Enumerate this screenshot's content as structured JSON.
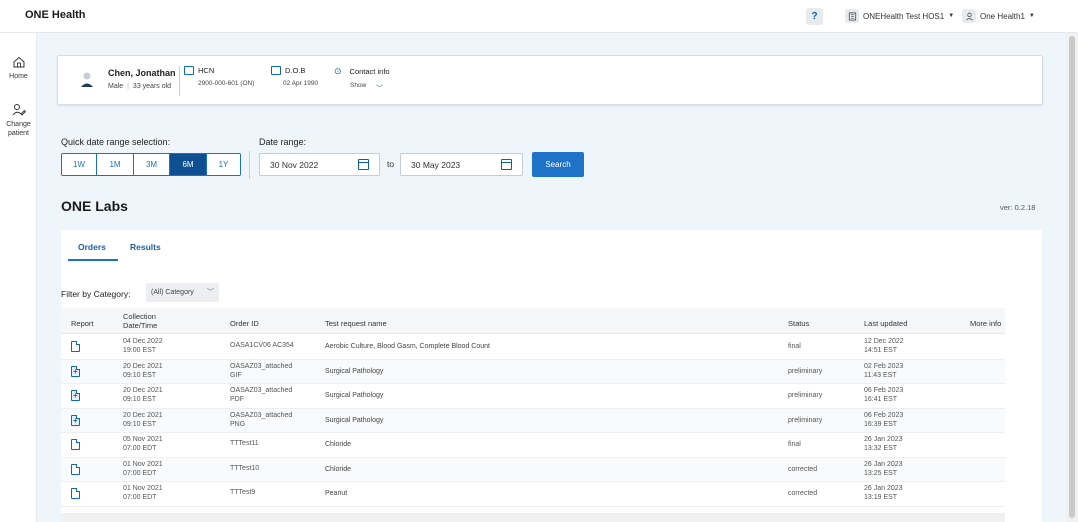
{
  "app": {
    "title": "ONE Health",
    "help": "?",
    "facility": "ONEHealth Test HOS1",
    "user": "One Health1"
  },
  "sidebar": {
    "items": [
      {
        "label": "Home",
        "icon": "home-icon"
      },
      {
        "label": "Change patient",
        "icon": "change-patient-icon"
      }
    ]
  },
  "patient": {
    "name": "Chen, Jonathan",
    "sex": "Male",
    "age": "33 years old",
    "hcn_label": "HCN",
    "hcn_value": "2900-000-601 (ON)",
    "dob_label": "D.O.B",
    "dob_value": "02 Apr 1990",
    "contact_label": "Contact info",
    "contact_value": "Show"
  },
  "date_controls": {
    "quick_label": "Quick date range selection:",
    "quick_options": [
      "1W",
      "1M",
      "3M",
      "6M",
      "1Y"
    ],
    "quick_selected": "6M",
    "range_label": "Date range:",
    "from": "30 Nov 2022",
    "to_word": "to",
    "to": "30 May 2023",
    "search": "Search"
  },
  "labs": {
    "title": "ONE Labs",
    "version": "ver: 0.2.18",
    "tabs": [
      "Orders",
      "Results"
    ],
    "active_tab": "Orders",
    "filter_label": "Filter by Category:",
    "filter_value": "(All) Category"
  },
  "table": {
    "headers": {
      "report": "Report",
      "collection": "Collection Date/Time",
      "order_id": "Order ID",
      "test": "Test request name",
      "status": "Status",
      "updated": "Last updated",
      "more": "More info"
    },
    "rows": [
      {
        "attached": false,
        "c1": "04 Dec 2022",
        "c2": "19:00 EST",
        "o1": "OASA1CV06 AC354",
        "o2": "",
        "test": "Aerobic Culture, Blood Gasm, Complete Blood Count",
        "status": "final",
        "u1": "12 Dec 2022",
        "u2": "14:51 EST"
      },
      {
        "attached": true,
        "c1": "20 Dec 2021",
        "c2": "09:10 EST",
        "o1": "OASAZ03_attached",
        "o2": "GIF",
        "test": "Surgical Pathology",
        "status": "preliminary",
        "u1": "02 Feb 2023",
        "u2": "11:43 EST"
      },
      {
        "attached": true,
        "c1": "20 Dec 2021",
        "c2": "09:10 EST",
        "o1": "OASAZ03_attached",
        "o2": "PDF",
        "test": "Surgical Pathology",
        "status": "preliminary",
        "u1": "06 Feb 2023",
        "u2": "16:41 EST"
      },
      {
        "attached": true,
        "c1": "20 Dec 2021",
        "c2": "09:10 EST",
        "o1": "OASAZ03_attached",
        "o2": "PNG",
        "test": "Surgical Pathology",
        "status": "preliminary",
        "u1": "06 Feb 2023",
        "u2": "16:39 EST"
      },
      {
        "attached": false,
        "c1": "05 Nov 2021",
        "c2": "07:00 EDT",
        "o1": "TTTest11",
        "o2": "",
        "test": "Chloride",
        "status": "final",
        "u1": "26 Jan 2023",
        "u2": "13:32 EST"
      },
      {
        "attached": false,
        "c1": "01 Nov 2021",
        "c2": "07:00 EDT",
        "o1": "TTTest10",
        "o2": "",
        "test": "Chloride",
        "status": "corrected",
        "u1": "26 Jan 2023",
        "u2": "13:25 EST"
      },
      {
        "attached": false,
        "c1": "01 Nov 2021",
        "c2": "07:00 EDT",
        "o1": "TTTest9",
        "o2": "",
        "test": "Peanut",
        "status": "corrected",
        "u1": "26 Jan 2023",
        "u2": "13:19 EST"
      }
    ]
  },
  "colors": {
    "accent": "#1e73c8",
    "active_segment": "#0d4f91",
    "background": "#eef5fb"
  }
}
